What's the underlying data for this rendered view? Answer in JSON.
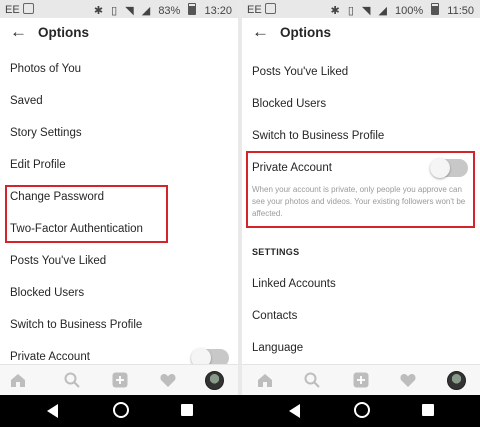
{
  "left": {
    "status": {
      "carrier": "EE",
      "battery": "83%",
      "time": "13:20"
    },
    "header": {
      "title": "Options"
    },
    "items": [
      {
        "label": "Photos of You"
      },
      {
        "label": "Saved"
      },
      {
        "label": "Story Settings"
      },
      {
        "label": "Edit Profile"
      },
      {
        "label": "Change Password"
      },
      {
        "label": "Two-Factor Authentication"
      },
      {
        "label": "Posts You've Liked"
      },
      {
        "label": "Blocked Users"
      },
      {
        "label": "Switch to Business Profile"
      },
      {
        "label": "Private Account"
      }
    ]
  },
  "right": {
    "status": {
      "carrier": "EE",
      "battery": "100%",
      "time": "11:50"
    },
    "header": {
      "title": "Options"
    },
    "items": [
      {
        "label": "Posts You've Liked"
      },
      {
        "label": "Blocked Users"
      },
      {
        "label": "Switch to Business Profile"
      },
      {
        "label": "Private Account"
      }
    ],
    "private_account_description": "When your account is private, only people you approve can see your photos and videos. Your existing followers won't be affected.",
    "settings_heading": "SETTINGS",
    "settings_items": [
      {
        "label": "Linked Accounts"
      },
      {
        "label": "Contacts"
      },
      {
        "label": "Language"
      }
    ]
  },
  "toggle_state": {
    "private_account_enabled": false
  },
  "colors": {
    "highlight": "#d3242b",
    "text": "#262626",
    "muted": "#9a9a9a",
    "toggle_off": "#c8c8c8"
  },
  "tabbar_icons": [
    "home-icon",
    "search-icon",
    "add-post-icon",
    "heart-icon",
    "profile-avatar"
  ],
  "navbar_icons": [
    "nav-back-icon",
    "nav-home-icon",
    "nav-recents-icon"
  ]
}
